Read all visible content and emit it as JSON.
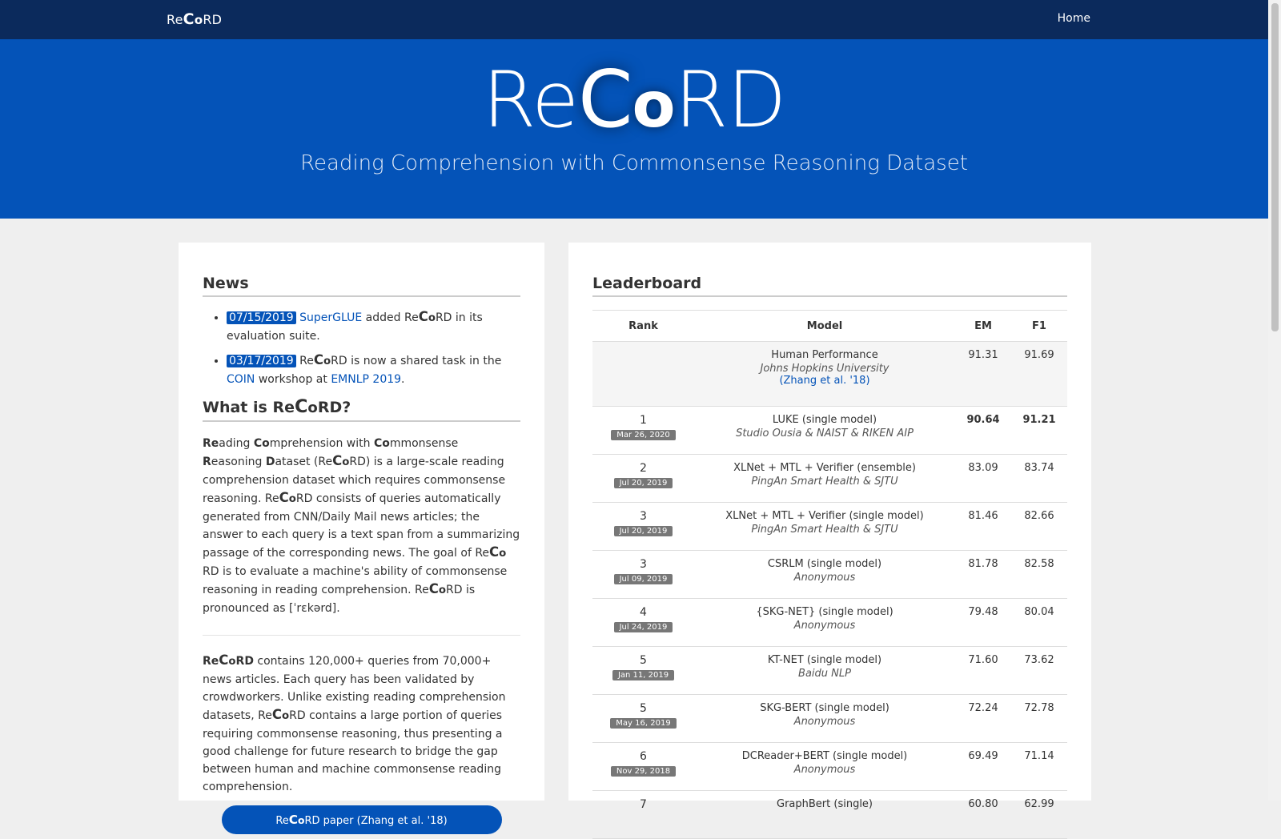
{
  "nav": {
    "brand": {
      "pre": "Re",
      "c": "C",
      "o": "o",
      "post": "RD"
    },
    "home": "Home"
  },
  "hero": {
    "title": {
      "pre": "Re",
      "c": "C",
      "o": "o",
      "post": "RD"
    },
    "subtitle": "Reading Comprehension with Commonsense Reasoning Dataset"
  },
  "news": {
    "title": "News",
    "items": [
      {
        "date": "07/15/2019",
        "link": "SuperGLUE",
        "text1": " added Re",
        "c": "C",
        "o": "o",
        "text2": "RD in its evaluation suite."
      },
      {
        "date": "03/17/2019",
        "text0": " Re",
        "c": "C",
        "o": "o",
        "text1": "RD is now a shared task in the ",
        "link1": "COIN",
        "text2": " workshop at ",
        "link2": "EMNLP 2019",
        "text3": "."
      }
    ]
  },
  "what": {
    "title_pre": "What is Re",
    "c": "C",
    "o": "o",
    "title_post": "RD?",
    "p1": {
      "b1": "Re",
      "t1": "ading ",
      "b2": "Co",
      "t2": "mprehension with ",
      "b3": "Co",
      "t3": "mmonsense ",
      "b4": "R",
      "t4": "easoning ",
      "b5": "D",
      "t5": "ataset (Re",
      "t6": "RD) is a large-scale reading comprehension dataset which requires commonsense reasoning. Re",
      "t7": "RD consists of queries automatically generated from CNN/Daily Mail news articles; the answer to each query is a text span from a summarizing passage of the corresponding news. The goal of Re",
      "t8": "RD is to evaluate a machine's ability of commonsense reasoning in reading comprehension. Re",
      "t9": "RD is pronounced as [ˈrɛkərd]."
    },
    "p2": {
      "b1": "Re",
      "b2": "RD",
      "t1": " contains 120,000+ queries from 70,000+ news articles. Each query has been validated by crowdworkers. Unlike existing reading comprehension datasets, Re",
      "t2": "RD contains a large portion of queries requiring commonsense reasoning, thus presenting a good challenge for future research to bridge the gap between human and machine commonsense reading comprehension."
    },
    "button": {
      "pre": "Re",
      "post": "RD paper (Zhang et al. '18)"
    }
  },
  "leaderboard": {
    "title": "Leaderboard",
    "headers": [
      "Rank",
      "Model",
      "EM",
      "F1"
    ],
    "human": {
      "model": "Human Performance",
      "affil": "Johns Hopkins University",
      "link": "(Zhang et al. '18)",
      "em": "91.31",
      "f1": "91.69"
    },
    "rows": [
      {
        "rank": "1",
        "date": "Mar 26, 2020",
        "model": "LUKE (single model)",
        "affil": "Studio Ousia & NAIST & RIKEN AIP",
        "em": "90.64",
        "f1": "91.21"
      },
      {
        "rank": "2",
        "date": "Jul 20, 2019",
        "model": "XLNet + MTL + Verifier (ensemble)",
        "affil": "PingAn Smart Health & SJTU",
        "em": "83.09",
        "f1": "83.74"
      },
      {
        "rank": "3",
        "date": "Jul 20, 2019",
        "model": "XLNet + MTL + Verifier (single model)",
        "affil": "PingAn Smart Health & SJTU",
        "em": "81.46",
        "f1": "82.66"
      },
      {
        "rank": "3",
        "date": "Jul 09, 2019",
        "model": "CSRLM (single model)",
        "affil": "Anonymous",
        "em": "81.78",
        "f1": "82.58"
      },
      {
        "rank": "4",
        "date": "Jul 24, 2019",
        "model": "{SKG-NET} (single model)",
        "affil": "Anonymous",
        "em": "79.48",
        "f1": "80.04"
      },
      {
        "rank": "5",
        "date": "Jan 11, 2019",
        "model": "KT-NET (single model)",
        "affil": "Baidu NLP",
        "em": "71.60",
        "f1": "73.62"
      },
      {
        "rank": "5",
        "date": "May 16, 2019",
        "model": "SKG-BERT (single model)",
        "affil": "Anonymous",
        "em": "72.24",
        "f1": "72.78"
      },
      {
        "rank": "6",
        "date": "Nov 29, 2018",
        "model": "DCReader+BERT (single model)",
        "affil": "Anonymous",
        "em": "69.49",
        "f1": "71.14"
      },
      {
        "rank": "7",
        "date": "",
        "model": "GraphBert (single)",
        "affil": "",
        "em": "60.80",
        "f1": "62.99"
      }
    ]
  }
}
